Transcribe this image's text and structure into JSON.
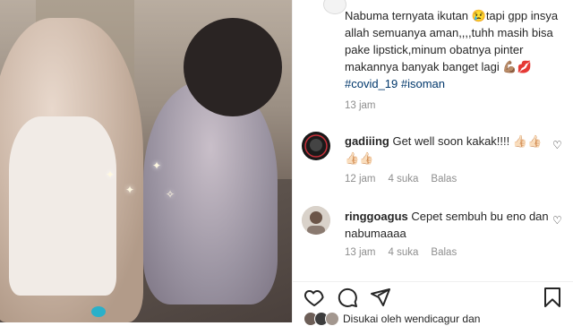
{
  "post": {
    "caption_text": "Nabuma ternyata ikutan 😢tapi gpp insya allah semuanya aman,,,,tuhh masih bisa pake lipstick,minum obatnya pinter makannya banyak banget lagi 💪🏽💋",
    "hashtags": "#covid_19 #isoman",
    "time": "13 jam"
  },
  "comments": [
    {
      "user": "gadiiing",
      "text": "Get well soon kakak!!!! 👍🏻👍🏻👍🏻👍🏻",
      "time": "12 jam",
      "likes": "4 suka",
      "reply": "Balas"
    },
    {
      "user": "ringgoagus",
      "text": "Cepet sembuh bu eno dan nabumaaaa",
      "time": "13 jam",
      "likes": "4 suka",
      "reply": "Balas"
    }
  ],
  "footer": {
    "liked_by": "Disukai oleh wendicagur dan"
  },
  "icons": {
    "like": "heart-icon",
    "comment": "comment-icon",
    "share": "share-icon",
    "save": "bookmark-icon"
  },
  "colors": {
    "text": "#262626",
    "secondary": "#8e8e8e",
    "hashtag": "#00376b"
  }
}
